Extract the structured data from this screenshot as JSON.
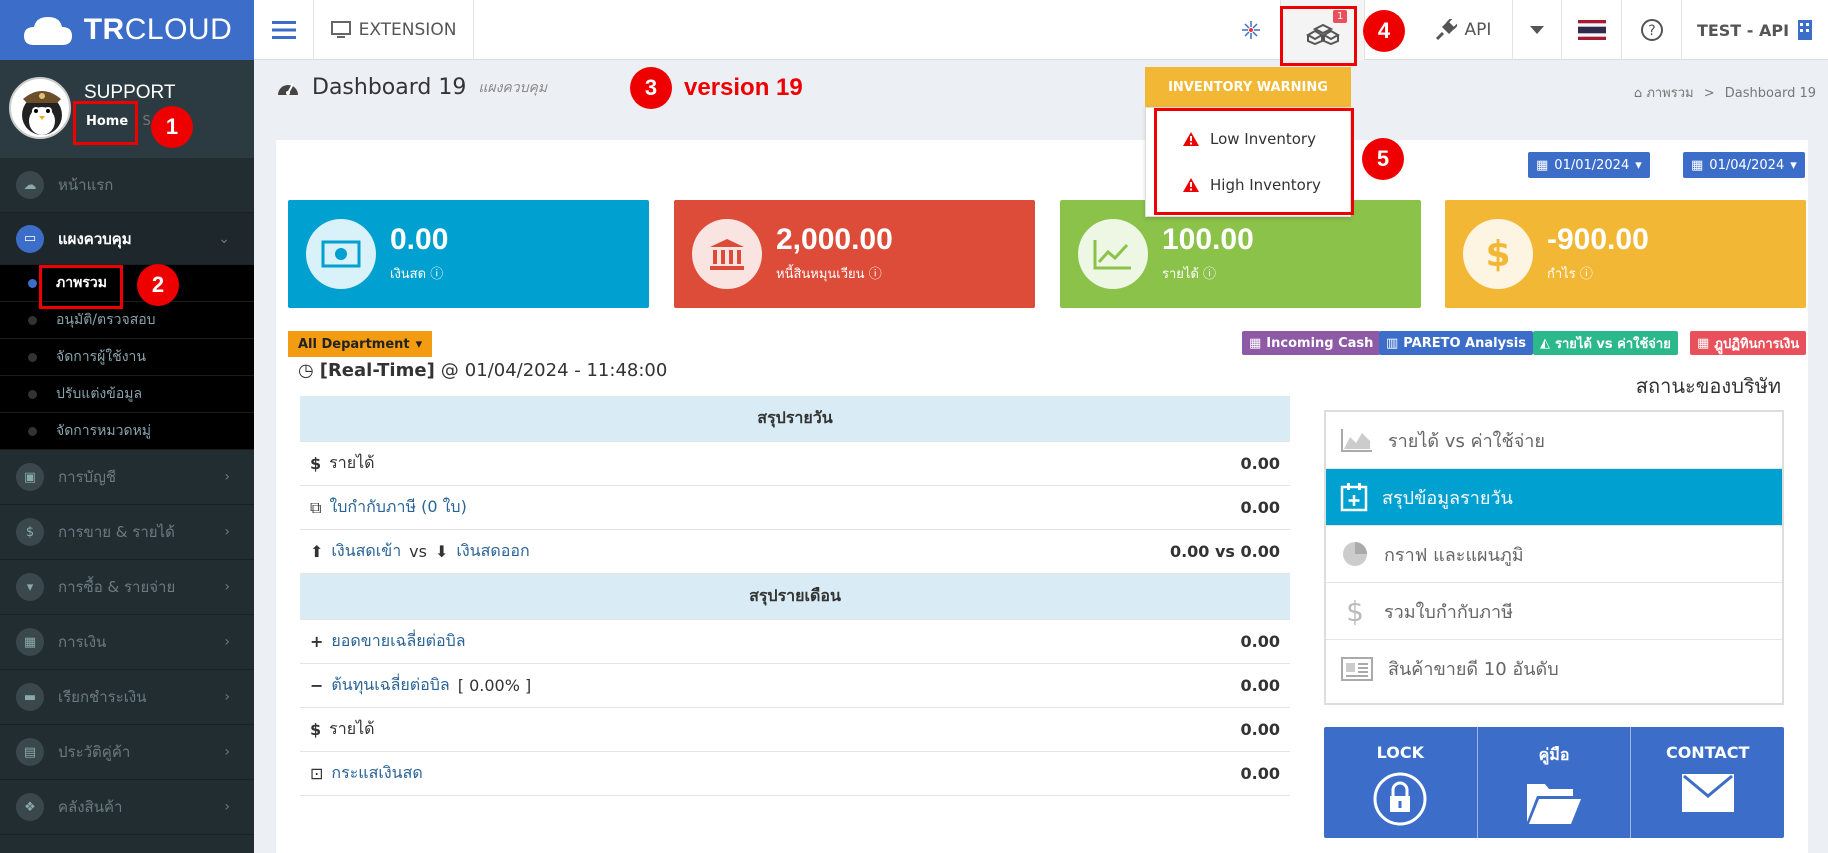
{
  "app": {
    "logo": "TRCLOUD",
    "logo_bold": "TR",
    "logo_rest": "CLOUD"
  },
  "topbar": {
    "extension_label": "EXTENSION",
    "api_label": "API",
    "user_label": "TEST - API",
    "notification_count": "1"
  },
  "sidebar": {
    "user_name": "SUPPORT",
    "home_link": "Home",
    "home_sep": "| S",
    "items": [
      {
        "label": "หน้าแรก"
      },
      {
        "label": "แผงควบคุม"
      },
      {
        "label": "การบัญชี"
      },
      {
        "label": "การขาย & รายได้"
      },
      {
        "label": "การซื้อ & รายจ่าย"
      },
      {
        "label": "การเงิน"
      },
      {
        "label": "เรียกชำระเงิน"
      },
      {
        "label": "ประวัติคู่ค้า"
      },
      {
        "label": "คลังสินค้า"
      }
    ],
    "sub_items": [
      {
        "label": "ภาพรวม"
      },
      {
        "label": "อนุมัติ/ตรวจสอบ"
      },
      {
        "label": "จัดการผู้ใช้งาน"
      },
      {
        "label": "ปรับแต่งข้อมูล"
      },
      {
        "label": "จัดการหมวดหมู่"
      }
    ]
  },
  "header": {
    "title": "Dashboard 19",
    "subtitle": "แผงควบคุม",
    "version_note": "version 19",
    "breadcrumb_home": "ภาพรวม",
    "breadcrumb_sep": ">",
    "breadcrumb_current": "Dashboard 19"
  },
  "dates": {
    "start": "01/01/2024",
    "end": "01/04/2024"
  },
  "stats": [
    {
      "value": "0.00",
      "label": "เงินสด",
      "color": "#00a0d0"
    },
    {
      "value": "2,000.00",
      "label": "หนี้สินหมุนเวียน",
      "color": "#dd4b39"
    },
    {
      "value": "100.00",
      "label": "รายได้",
      "color": "#8bc34a"
    },
    {
      "value": "-900.00",
      "label": "กำไร",
      "color": "#f2b835"
    }
  ],
  "department": {
    "label": "All Department"
  },
  "realtime": {
    "label": "[Real-Time]",
    "at": "@",
    "datetime": "01/04/2024 - 11:48:00"
  },
  "actions": [
    {
      "label": "Incoming Cash",
      "color": "#8e5aa6"
    },
    {
      "label": "PARETO Analysis",
      "color": "#3c6ec9"
    },
    {
      "label": "รายได้ vs ค่าใช้จ่าย",
      "color": "#2bb88a"
    },
    {
      "label": "ฎูปฏิทินการเงิน",
      "color": "#e8505b"
    }
  ],
  "daily": {
    "header": "สรุปรายวัน",
    "rows": [
      {
        "label": "รายได้",
        "value": "0.00"
      },
      {
        "label": "ใบกำกับภาษี (0 ใบ)",
        "value": "0.00"
      },
      {
        "label_in": "เงินสดเข้า",
        "vs": "vs",
        "label_out": "เงินสดออก",
        "value": "0.00 vs 0.00"
      }
    ]
  },
  "monthly": {
    "header": "สรุปรายเดือน",
    "rows": [
      {
        "label": "ยอดขายเฉลี่ยต่อบิล",
        "value": "0.00"
      },
      {
        "label": "ต้นทุนเฉลี่ยต่อบิล",
        "extra": "[ 0.00% ]",
        "value": "0.00"
      },
      {
        "label": "รายได้",
        "value": "0.00"
      },
      {
        "label": "กระแสเงินสด",
        "value": "0.00"
      }
    ]
  },
  "company_status": {
    "title": "สถานะของบริษัท",
    "items": [
      {
        "label": "รายได้ vs ค่าใช้จ่าย"
      },
      {
        "label": "สรุปข้อมูลรายวัน"
      },
      {
        "label": "กราฟ และแผนภูมิ"
      },
      {
        "label": "รวมใบกำกับภาษี"
      },
      {
        "label": "สินค้าขายดี 10 อันดับ"
      }
    ]
  },
  "bottom_buttons": [
    {
      "label": "LOCK"
    },
    {
      "label": "คู่มือ"
    },
    {
      "label": "CONTACT"
    }
  ],
  "inventory": {
    "header": "INVENTORY WARNING",
    "items": [
      {
        "label": "Low Inventory"
      },
      {
        "label": "High Inventory"
      }
    ]
  },
  "annotations": [
    "1",
    "2",
    "3",
    "4",
    "5"
  ]
}
